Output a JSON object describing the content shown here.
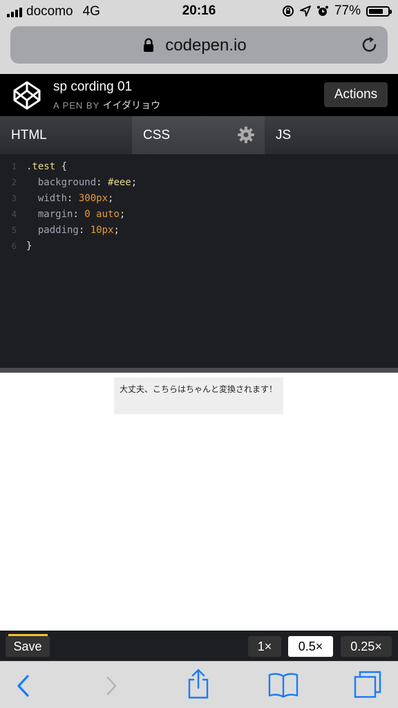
{
  "status_bar": {
    "carrier": "docomo",
    "network": "4G",
    "time": "20:16",
    "battery_percent": "77%",
    "battery_level": 0.77
  },
  "browser": {
    "url": "codepen.io"
  },
  "codepen": {
    "title": "sp cording 01",
    "by_label": "A PEN BY",
    "author": "イイダリョウ",
    "actions_label": "Actions"
  },
  "tabs": [
    {
      "label": "HTML",
      "active": false
    },
    {
      "label": "CSS",
      "active": true
    },
    {
      "label": "JS",
      "active": false
    }
  ],
  "editor": {
    "line_numbers": [
      "1",
      "2",
      "3",
      "4",
      "5",
      "6"
    ],
    "lines": [
      ".test {",
      "  background: #eee;",
      "  width: 300px;",
      "  margin: 0 auto;",
      "  padding: 10px;",
      "}"
    ]
  },
  "preview": {
    "text": "大丈夫、こちらはちゃんと変換されます！"
  },
  "bottom_bar": {
    "save_label": "Save",
    "zoom_options": [
      "1×",
      "0.5×",
      "0.25×"
    ],
    "zoom_selected": "0.5×"
  },
  "safari_toolbar": {
    "icons": [
      "back-icon",
      "forward-icon",
      "share-icon",
      "bookmarks-icon",
      "tabs-icon"
    ]
  },
  "colors": {
    "codepen_bg": "#000000",
    "editor_bg": "#1d1e22",
    "save_accent": "#f5c033"
  }
}
